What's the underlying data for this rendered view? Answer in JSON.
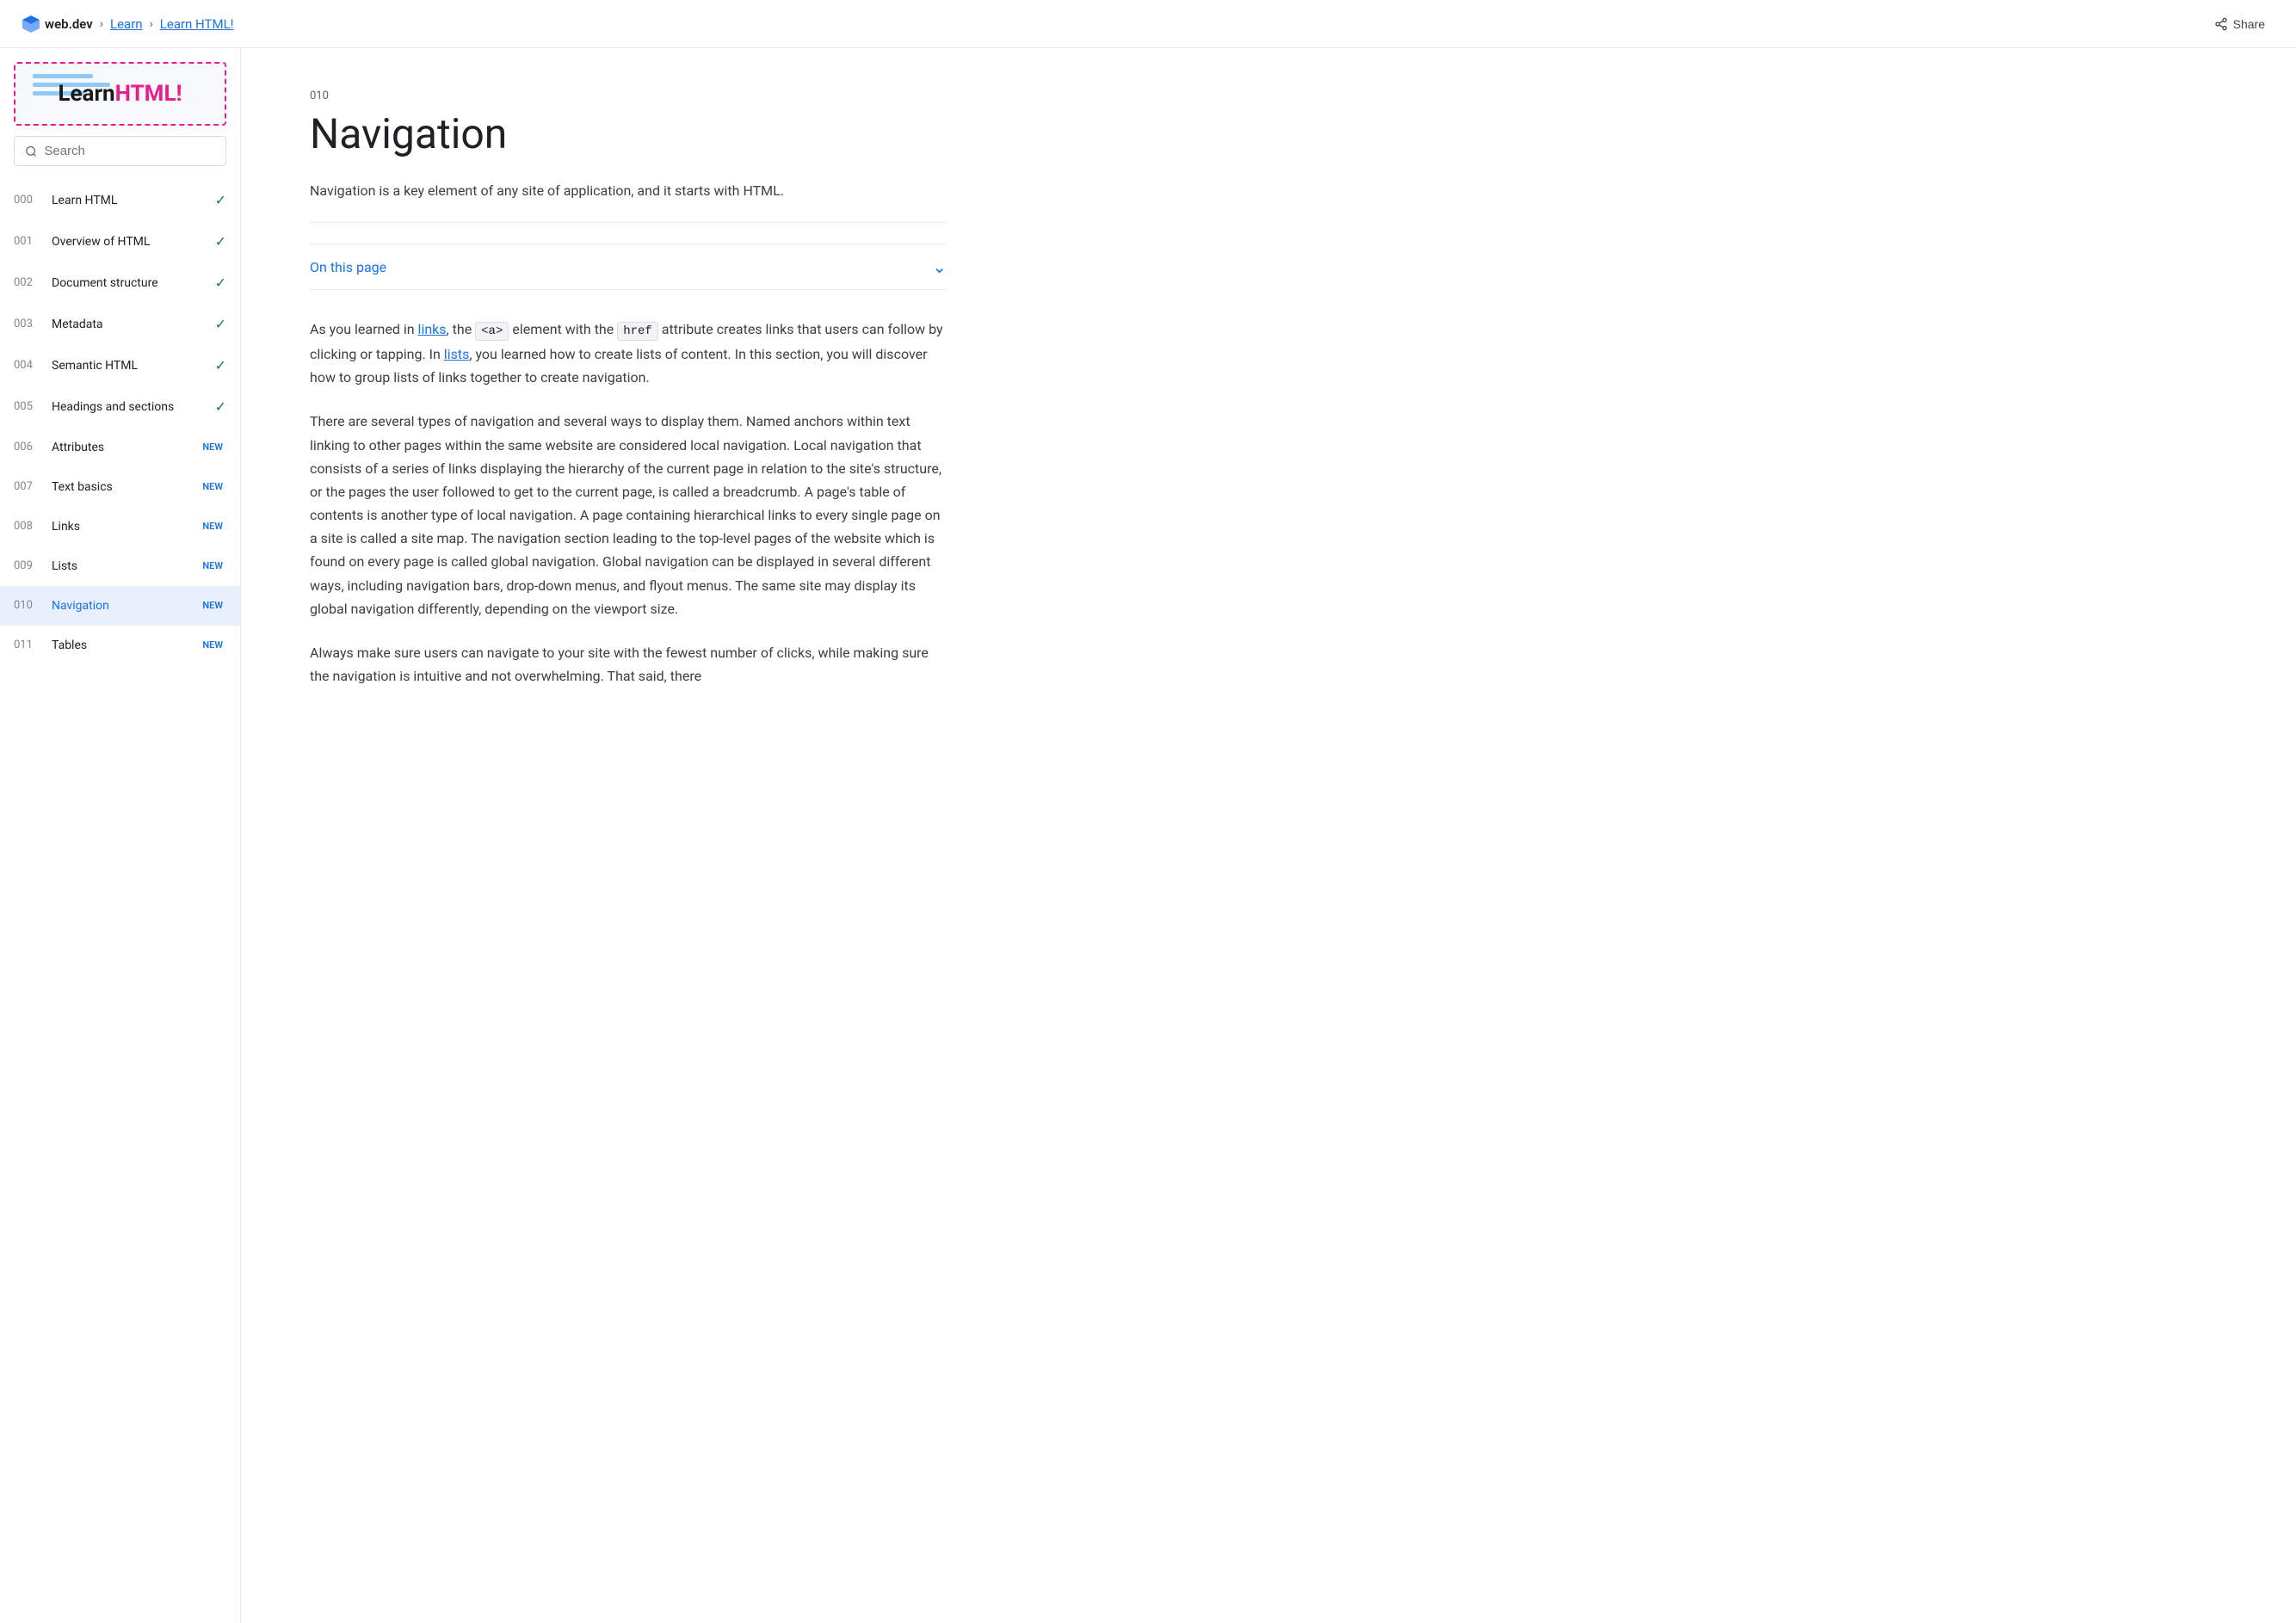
{
  "topnav": {
    "brand": "web.dev",
    "breadcrumbs": [
      "Learn",
      "Learn HTML!"
    ],
    "share_label": "Share"
  },
  "sidebar": {
    "logo_learn": "Learn",
    "logo_html": "HTML!",
    "search_placeholder": "Search",
    "nav_items": [
      {
        "num": "000",
        "label": "Learn HTML",
        "badge": "check",
        "active": false
      },
      {
        "num": "001",
        "label": "Overview of HTML",
        "badge": "check",
        "active": false
      },
      {
        "num": "002",
        "label": "Document structure",
        "badge": "check",
        "active": false
      },
      {
        "num": "003",
        "label": "Metadata",
        "badge": "check",
        "active": false
      },
      {
        "num": "004",
        "label": "Semantic HTML",
        "badge": "check",
        "active": false
      },
      {
        "num": "005",
        "label": "Headings and sections",
        "badge": "check",
        "active": false
      },
      {
        "num": "006",
        "label": "Attributes",
        "badge": "NEW",
        "active": false
      },
      {
        "num": "007",
        "label": "Text basics",
        "badge": "NEW",
        "active": false
      },
      {
        "num": "008",
        "label": "Links",
        "badge": "NEW",
        "active": false
      },
      {
        "num": "009",
        "label": "Lists",
        "badge": "NEW",
        "active": false
      },
      {
        "num": "010",
        "label": "Navigation",
        "badge": "NEW",
        "active": true
      },
      {
        "num": "011",
        "label": "Tables",
        "badge": "NEW",
        "active": false
      }
    ]
  },
  "article": {
    "num": "010",
    "title": "Navigation",
    "description": "Navigation is a key element of any site of application, and it starts with HTML.",
    "on_this_page": "On this page",
    "body_paragraphs": [
      "As you learned in links, the <a> element with the href attribute creates links that users can follow by clicking or tapping. In lists, you learned how to create lists of content. In this section, you will discover how to group lists of links together to create navigation.",
      "There are several types of navigation and several ways to display them. Named anchors within text linking to other pages within the same website are considered local navigation. Local navigation that consists of a series of links displaying the hierarchy of the current page in relation to the site's structure, or the pages the user followed to get to the current page, is called a breadcrumb. A page's table of contents is another type of local navigation. A page containing hierarchical links to every single page on a site is called a site map. The navigation section leading to the top-level pages of the website which is found on every page is called global navigation. Global navigation can be displayed in several different ways, including navigation bars, drop-down menus, and flyout menus. The same site may display its global navigation differently, depending on the viewport size.",
      "Always make sure users can navigate to your site with the fewest number of clicks, while making sure the navigation is intuitive and not overwhelming. That said, there"
    ]
  }
}
